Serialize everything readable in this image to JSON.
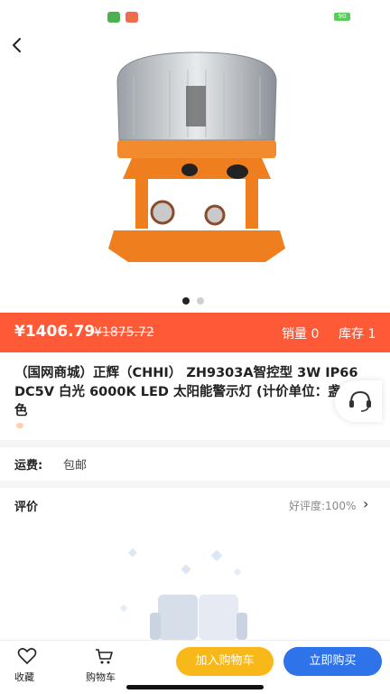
{
  "status": {
    "battery": "90"
  },
  "product": {
    "price": "¥1406.79",
    "original_price": "¥1875.72",
    "sales": "销量 0",
    "stock": "库存 1",
    "title": "（国网商城）正辉（CHHI） ZH9303A智控型 3W IP66 DC5V 白光 6000K LED 太阳能警示灯 (计价单位：盏) 黄色"
  },
  "shipping": {
    "label": "运费:",
    "value": "包邮"
  },
  "reviews": {
    "label": "评价",
    "rating": "好评度:100%"
  },
  "bottom": {
    "favorite": "收藏",
    "cart": "购物车",
    "add_to_cart": "加入购物车",
    "buy_now": "立即购买"
  },
  "colors": {
    "accent": "#ff5a38",
    "add_button": "#f9b81a",
    "buy_button": "#2f73eb"
  },
  "carousel": {
    "current": 1,
    "total": 2
  }
}
